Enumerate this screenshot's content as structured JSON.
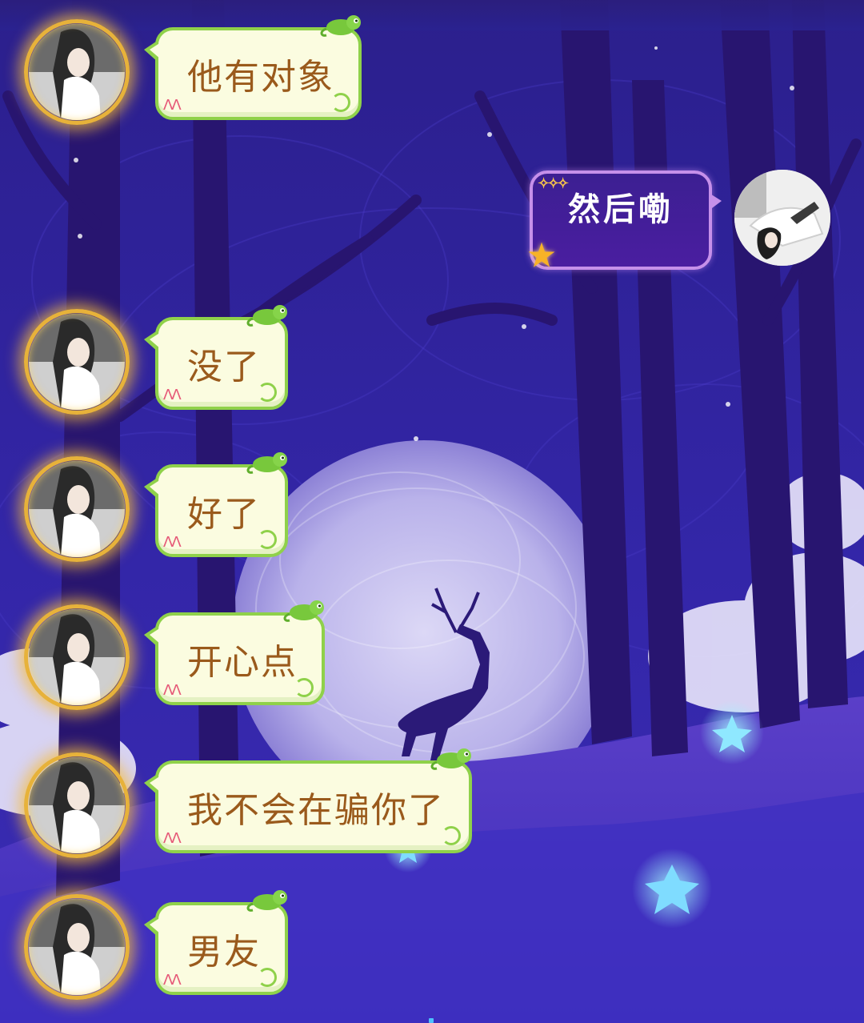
{
  "chat": {
    "incoming_messages": [
      {
        "text": "他有对象"
      },
      {
        "text": "没了"
      },
      {
        "text": "好了"
      },
      {
        "text": "开心点"
      },
      {
        "text": "我不会在骗你了"
      },
      {
        "text": "男友"
      }
    ],
    "outgoing_message": {
      "text": "然后嘞"
    }
  },
  "icons": {
    "avatar_frame": "golden-magic-circle-avatar-frame",
    "bubble_decoration": "chameleon-icon",
    "outgoing_bubble_decoration": "star-icon"
  },
  "colors": {
    "background": "#2a1f86",
    "incoming_bubble_fill": "#fbfce0",
    "incoming_bubble_border": "#8fd14a",
    "incoming_text": "#9a5a1c",
    "outgoing_bubble_fill": "#3c1f92",
    "outgoing_bubble_border": "#c690ea",
    "outgoing_text": "#ffffff"
  }
}
